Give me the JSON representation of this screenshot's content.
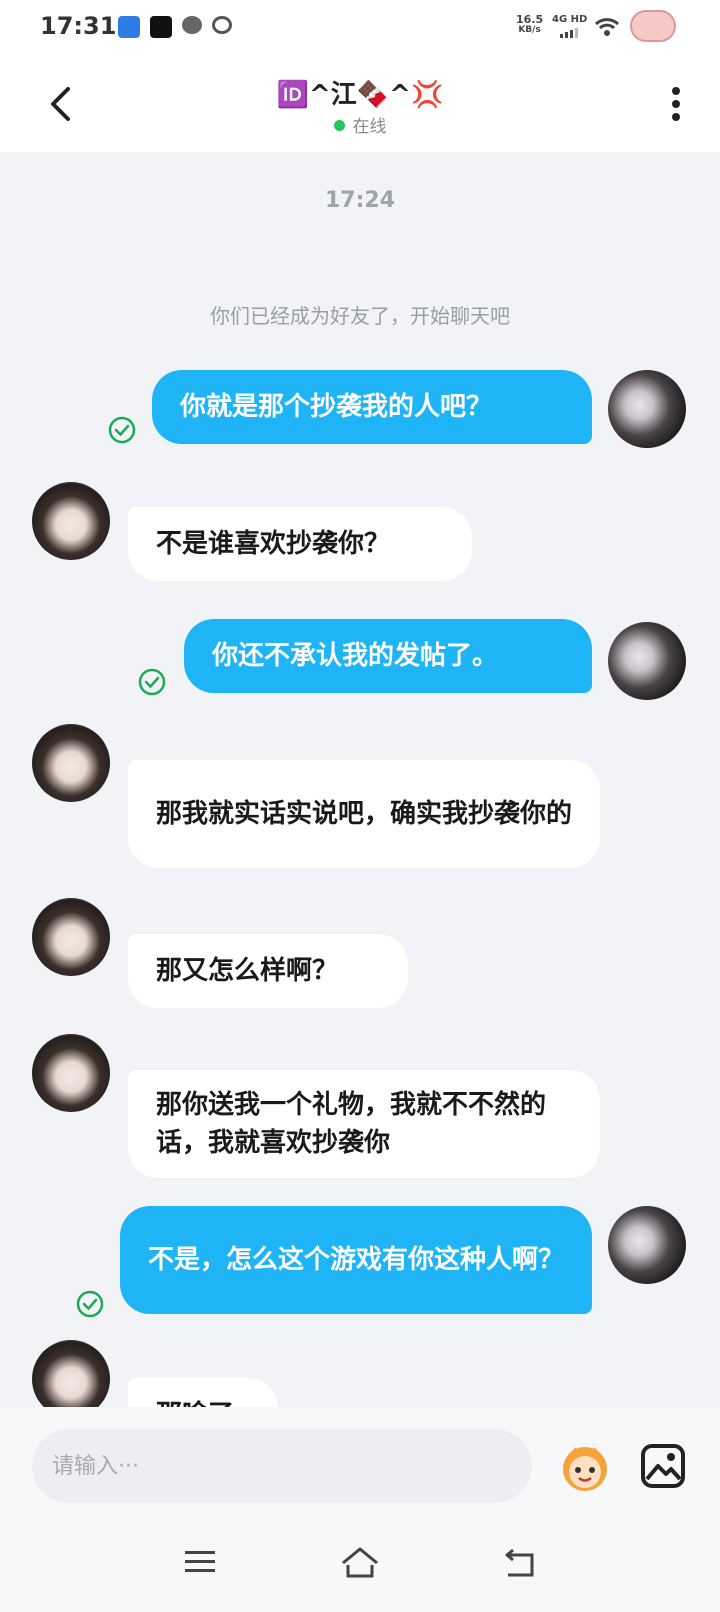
{
  "status_bar": {
    "time": "17:31",
    "net_speed": "16.5",
    "net_speed_unit": "KB/s",
    "network_type": "4G HD",
    "icons": [
      "app-notification-icon",
      "star-app-icon",
      "wechat-icon",
      "ring-icon",
      "signal-icon",
      "wifi-icon",
      "battery-pig-icon"
    ]
  },
  "header": {
    "title": "🆔^江🍫^💢",
    "online_status": "在线",
    "back_icon": "chevron-left-icon",
    "menu_icon": "vertical-ellipsis-icon"
  },
  "chat": {
    "timestamp": "17:24",
    "system_notice": "你们已经成为好友了，开始聊天吧",
    "messages": [
      {
        "sender": "me",
        "text": "你就是那个抄袭我的人吧？",
        "status": "sent"
      },
      {
        "sender": "other",
        "text": "不是谁喜欢抄袭你？"
      },
      {
        "sender": "me",
        "text": "你还不承认我的发帖了。",
        "status": "sent"
      },
      {
        "sender": "other",
        "text": "那我就实话实说吧，确实我抄袭你的"
      },
      {
        "sender": "other",
        "text": "那又怎么样啊？"
      },
      {
        "sender": "other",
        "text": "那你送我一个礼物，我就不不然的话，我就喜欢抄袭你"
      },
      {
        "sender": "me",
        "text": "不是，怎么这个游戏有你这种人啊？",
        "status": "sent"
      },
      {
        "sender": "other",
        "text": "那啥了"
      }
    ]
  },
  "input_bar": {
    "placeholder": "请输入···",
    "value": ""
  },
  "colors": {
    "my_bubble": "#1fb4f6",
    "other_bubble": "#ffffff",
    "background": "#f1f3f6",
    "sent_check": "#1aaa55",
    "online_dot": "#22c55e"
  }
}
